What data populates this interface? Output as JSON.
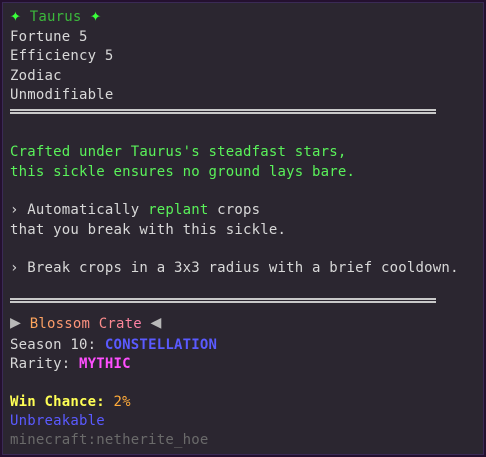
{
  "header": {
    "star_left": "✦",
    "title": "Taurus",
    "star_right": "✦"
  },
  "enchants": [
    "Fortune 5",
    "Efficiency 5",
    "Zodiac",
    "Unmodifiable"
  ],
  "lore": {
    "line1": "Crafted under Taurus's steadfast stars,",
    "line2": "this sickle ensures no ground lays bare."
  },
  "ability1": {
    "prefix": "› Automatically ",
    "highlight": "replant",
    "suffix": " crops",
    "line2": "that you break with this sickle."
  },
  "ability2": {
    "text": "› Break crops in a 3x3 radius with a brief cooldown."
  },
  "crate": {
    "arrow_left": "▶",
    "name": "Blossom Crate",
    "arrow_right": "◀"
  },
  "season": {
    "label": "Season 10: ",
    "value": "CONSTELLATION"
  },
  "rarity": {
    "label": "Rarity: ",
    "value": "MYTHIC"
  },
  "win_chance": {
    "label": "Win Chance:",
    "value": " 2%"
  },
  "unbreakable": "Unbreakable",
  "item_id": "minecraft:netherite_hoe",
  "colors": {
    "background": "#2b2630",
    "border": "#24102f",
    "title_green": "#3cb83c",
    "lore_green": "#5af25a",
    "constellation_blue": "#5a5aff",
    "mythic_magenta": "#ff4fff",
    "win_yellow": "#ffff55",
    "chance_orange": "#ffab3a"
  }
}
